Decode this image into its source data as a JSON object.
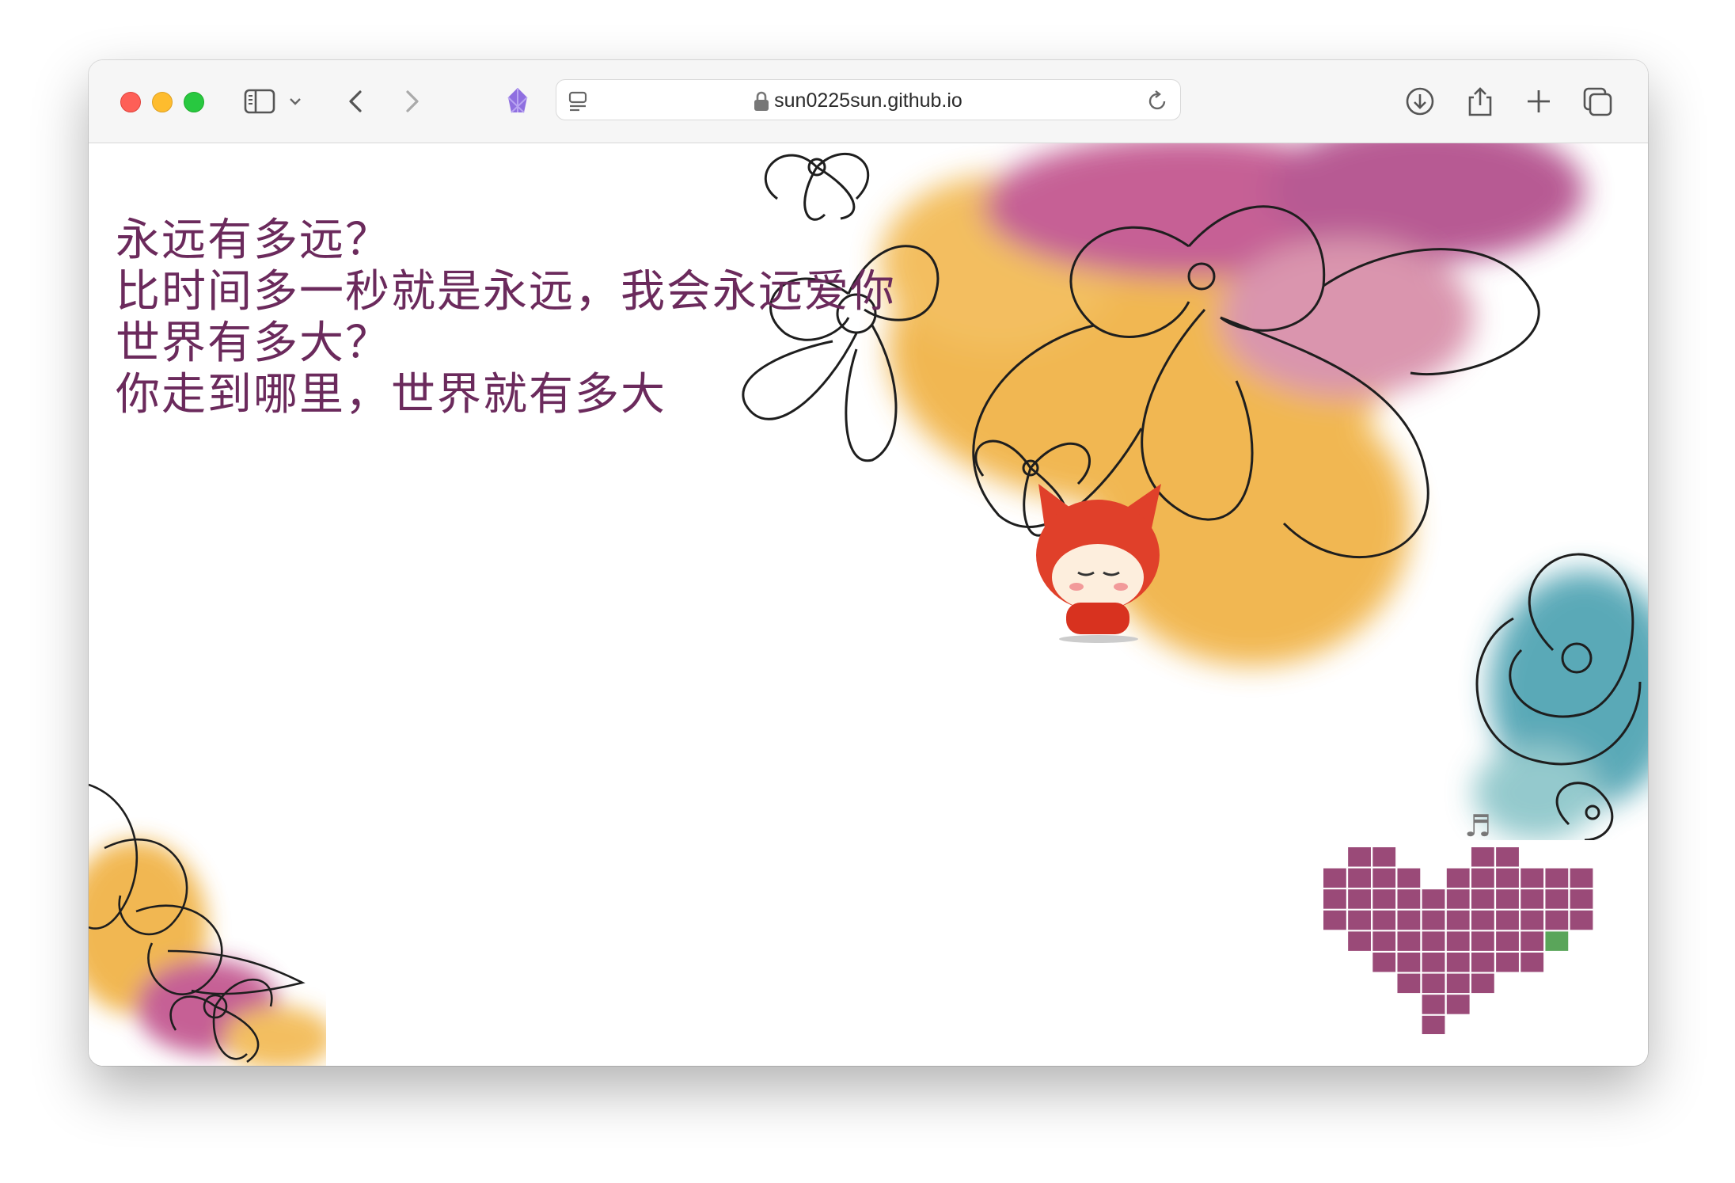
{
  "browser": {
    "url": "sun0225sun.github.io",
    "icons": [
      "sidebar-icon",
      "chevron-down-icon",
      "back-icon",
      "forward-icon",
      "extension-icon",
      "reader-icon",
      "lock-icon",
      "reload-icon",
      "download-icon",
      "share-icon",
      "new-tab-icon",
      "tabs-overview-icon"
    ]
  },
  "page": {
    "lines": [
      "永远有多远？",
      "比时间多一秒就是永远，我会永远爱你",
      "世界有多大？",
      "你走到哪里，世界就有多大"
    ],
    "music_note": "♬",
    "colors": {
      "text": "#6b2a5c",
      "heart": "#9a4a78",
      "heart_accent": "#5aa55a",
      "flower_orange": "#f0b040",
      "flower_pink": "#c0508a",
      "flower_teal": "#4aa0b0",
      "fox": "#e0402a"
    }
  }
}
